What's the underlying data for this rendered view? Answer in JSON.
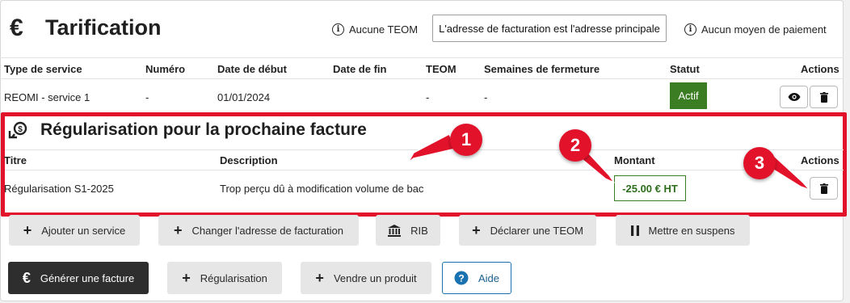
{
  "header": {
    "euro_icon": "€",
    "title": "Tarification",
    "teom_info": "Aucune TEOM",
    "billing_address": "L'adresse de facturation est l'adresse principale",
    "payment_info": "Aucun moyen de paiement"
  },
  "services": {
    "columns": [
      "Type de service",
      "Numéro",
      "Date de début",
      "Date de fin",
      "TEOM",
      "Semaines de fermeture",
      "Statut",
      "Actions"
    ],
    "rows": [
      {
        "type": "REOMI - service 1",
        "numero": "-",
        "date_debut": "01/01/2024",
        "date_fin": "",
        "teom": "-",
        "semaines": "-",
        "statut": "Actif"
      }
    ]
  },
  "regularisation": {
    "title": "Régularisation pour la prochaine facture",
    "columns": [
      "Titre",
      "Description",
      "Montant",
      "Actions"
    ],
    "rows": [
      {
        "titre": "Régularisation S1-2025",
        "description": "Trop perçu dû à modification volume de bac",
        "montant": "-25.00 € HT"
      }
    ]
  },
  "actions_row1": {
    "add_service": "Ajouter un service",
    "change_address": "Changer l'adresse de facturation",
    "rib": "RIB",
    "declare_teom": "Déclarer une TEOM",
    "suspend": "Mettre en suspens"
  },
  "actions_row2": {
    "generate_invoice": "Générer une facture",
    "regularisation": "Régularisation",
    "sell_product": "Vendre un produit",
    "help": "Aide"
  },
  "callouts": [
    "1",
    "2",
    "3"
  ],
  "icons": {
    "euro": "euro-icon",
    "info": "info-circle-icon",
    "eye": "eye-icon",
    "trash": "trash-icon",
    "coins": "coins-refresh-icon",
    "plus": "plus-icon",
    "bank": "bank-icon",
    "pause": "pause-icon",
    "help": "help-circle-icon"
  },
  "colors": {
    "active_green": "#3b7d23",
    "callout_red": "#e3122b",
    "help_blue": "#1a73b0",
    "dark_button": "#2e2e2e"
  }
}
